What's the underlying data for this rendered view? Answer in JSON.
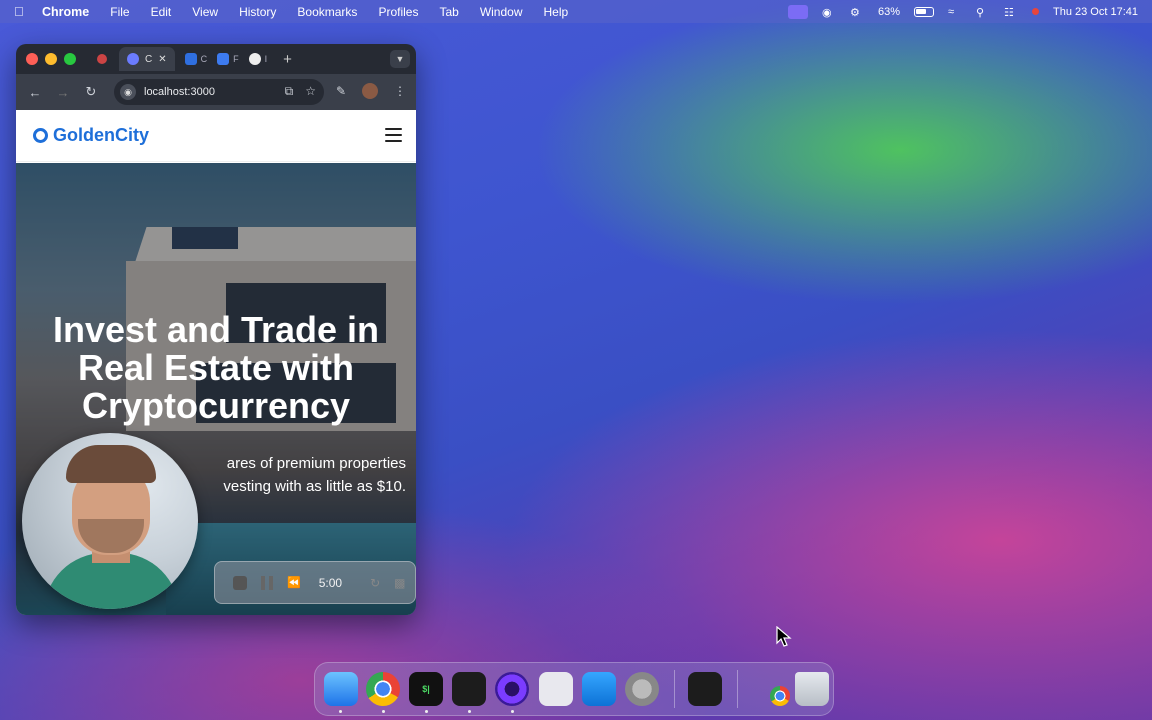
{
  "menubar": {
    "app_name": "Chrome",
    "items": [
      "File",
      "Edit",
      "View",
      "History",
      "Bookmarks",
      "Profiles",
      "Tab",
      "Window",
      "Help"
    ],
    "battery": "63%",
    "datetime": "Thu 23 Oct  17:41"
  },
  "browser": {
    "tabs": {
      "active_short": "C",
      "small_1": "C",
      "small_2": "F",
      "small_3": "I"
    },
    "url": "localhost:3000"
  },
  "site": {
    "brand": "GoldenCity",
    "hero_title": "Invest and Trade in Real Estate with Cryptocurrency",
    "hero_sub_line1": "ares of premium properties",
    "hero_sub_line2": "vesting with as little as $10."
  },
  "recorder": {
    "time": "5:00"
  },
  "colors": {
    "brand": "#1e6fd9",
    "menubar_accent": "#7b6cf5"
  },
  "dock": {
    "terminal_label": "$|"
  }
}
